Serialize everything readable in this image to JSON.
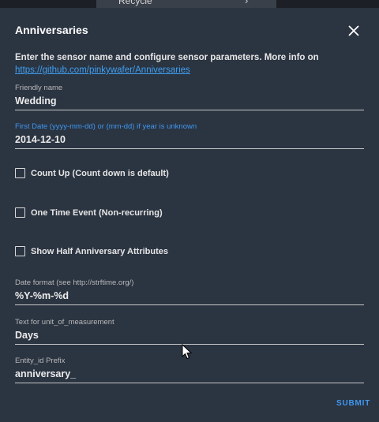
{
  "background": {
    "list_item_label": "Recycle"
  },
  "dialog": {
    "title": "Anniversaries",
    "intro_text": "Enter the sensor name and configure sensor parameters. More info on",
    "intro_link": "https://github.com/pinkywafer/Anniversaries",
    "submit_label": "SUBMIT"
  },
  "fields": {
    "friendly_name": {
      "label": "Friendly name",
      "value": "Wedding"
    },
    "first_date": {
      "label": "First Date (yyyy-mm-dd) or (mm-dd) if year is unknown",
      "value": "2014-12-10"
    },
    "date_format": {
      "label": "Date format (see http://strftime.org/)",
      "value": "%Y-%m-%d"
    },
    "unit": {
      "label": "Text for unit_of_measurement",
      "value": "Days"
    },
    "prefix": {
      "label": "Entity_id Prefix",
      "value": "anniversary_"
    }
  },
  "checkboxes": {
    "count_up": {
      "label": "Count Up (Count down is default)",
      "checked": false
    },
    "one_time": {
      "label": "One Time Event (Non-recurring)",
      "checked": false
    },
    "half": {
      "label": "Show Half Anniversary Attributes",
      "checked": false
    }
  },
  "colors": {
    "dialog_bg": "#2b3441",
    "accent": "#3f97ef",
    "link": "#3fa0f3"
  },
  "icons": {
    "close": "close-icon",
    "chevron": "chevron-right-icon",
    "cursor": "mouse-pointer-icon"
  }
}
